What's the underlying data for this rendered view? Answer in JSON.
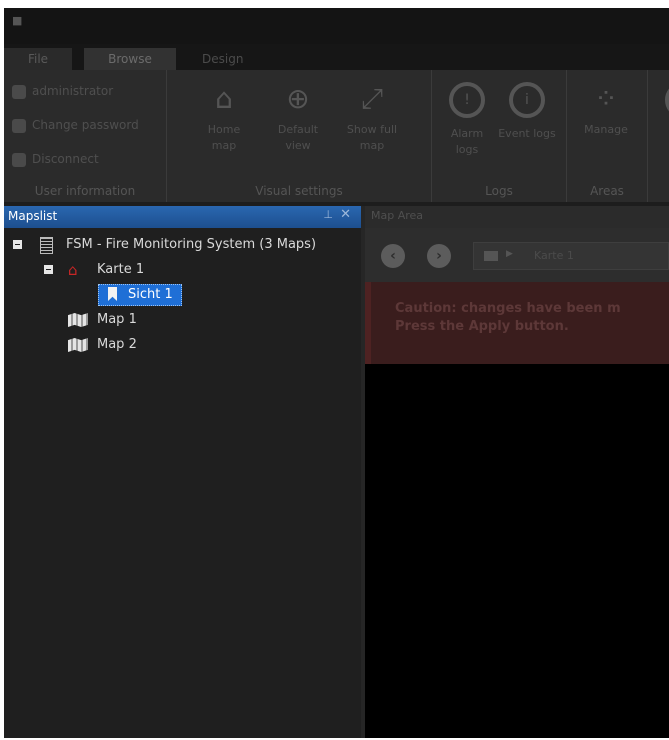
{
  "menu": {
    "tabs": [
      "File",
      "Browse",
      "Design"
    ]
  },
  "ribbon": {
    "user": {
      "name": "administrator",
      "change_password": "Change password",
      "disconnect": "Disconnect",
      "group_title": "User information"
    },
    "visual": {
      "home_map": "Home map",
      "default_view": "Default view",
      "show_full_map": "Show full map",
      "group_title": "Visual settings"
    },
    "logs": {
      "alarm_logs": "Alarm logs",
      "event_logs": "Event logs",
      "group_title": "Logs"
    },
    "areas": {
      "manage": "Manage",
      "group_title": "Areas"
    }
  },
  "maps_panel": {
    "title": "Mapslist",
    "pin_icon": "pin-icon",
    "close_icon": "close-icon",
    "tree": {
      "root": "FSM - Fire Monitoring System (3 Maps)",
      "karte": "Karte 1",
      "sicht": "Sicht 1",
      "map1": "Map 1",
      "map2": "Map 2"
    }
  },
  "map_area": {
    "title": "Map Area",
    "breadcrumb": "Karte 1",
    "caution_line1": "Caution: changes have been m",
    "caution_line2": "Press the Apply button."
  },
  "colors": {
    "panel_header": "#2a67b0",
    "selection": "#1f6fd6",
    "home_icon": "#c72626",
    "background": "#1d1d1d"
  }
}
